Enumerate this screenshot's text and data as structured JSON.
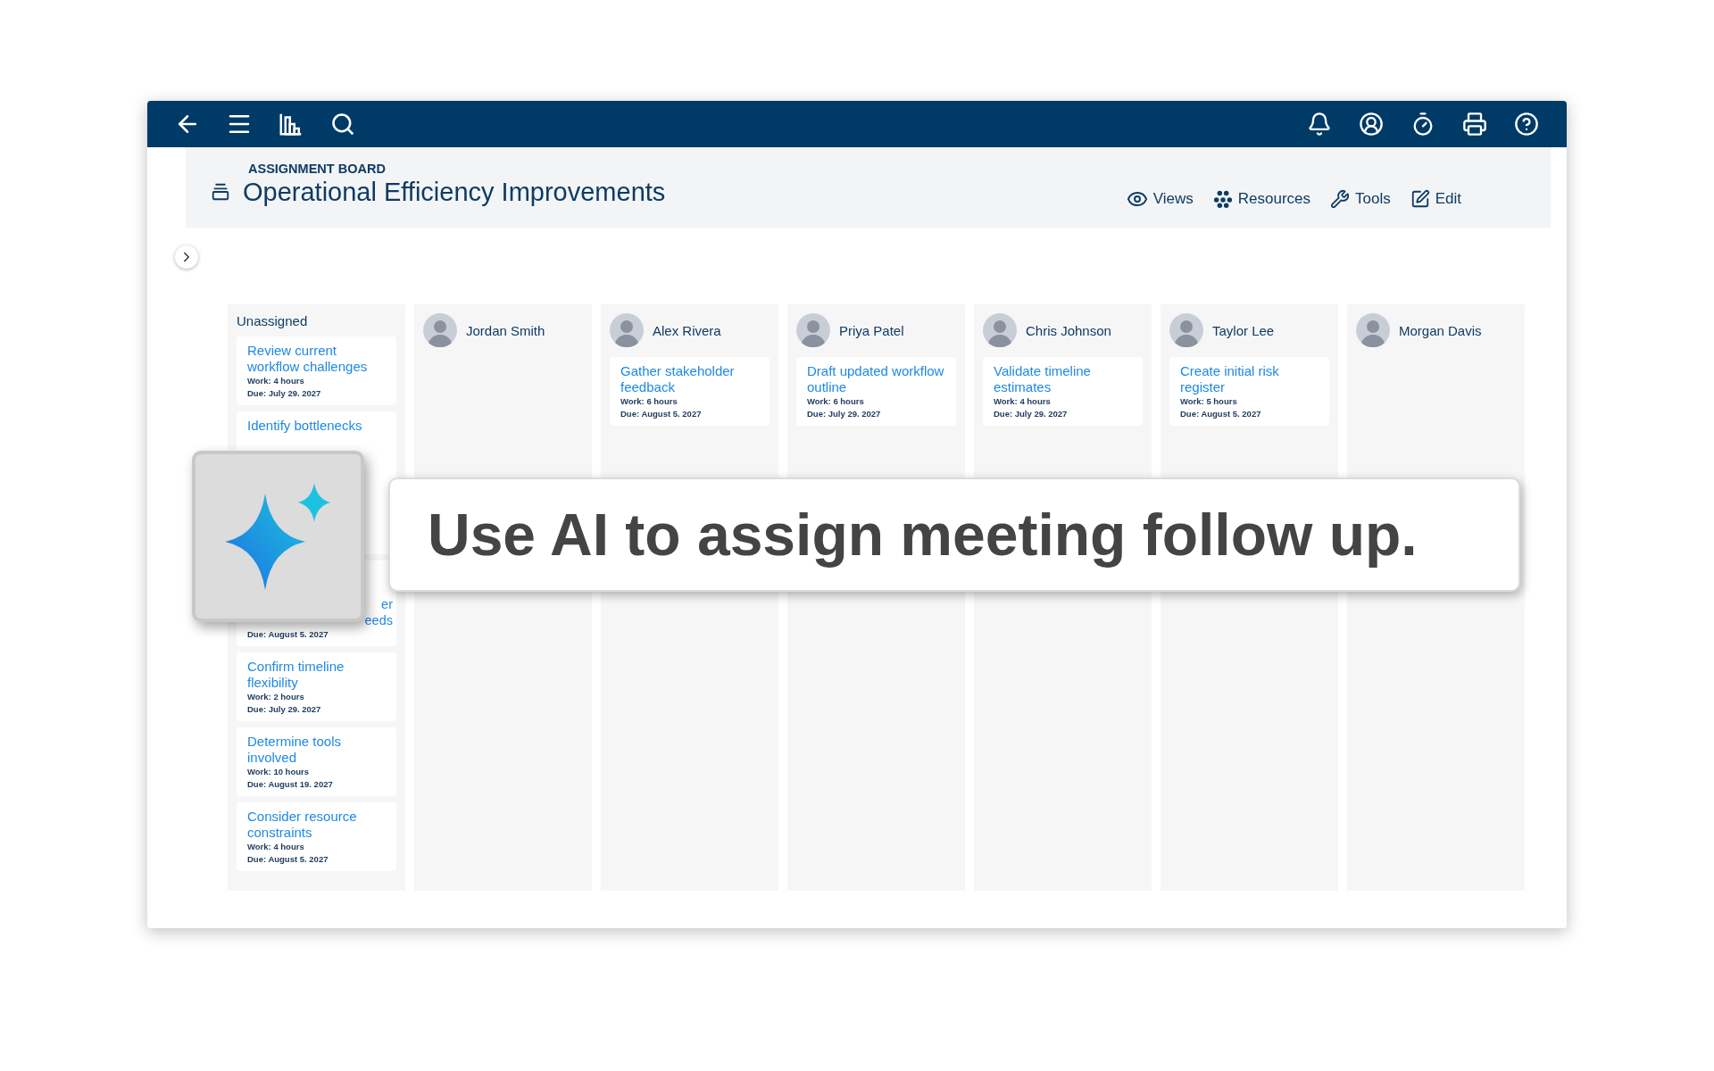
{
  "header": {
    "eyebrow": "ASSIGNMENT BOARD",
    "title": "Operational Efficiency Improvements",
    "actions": [
      {
        "kind": "views",
        "label": "Views"
      },
      {
        "kind": "resources",
        "label": "Resources"
      },
      {
        "kind": "tools",
        "label": "Tools"
      },
      {
        "kind": "edit",
        "label": "Edit"
      }
    ]
  },
  "columns": [
    {
      "kind": "unassigned",
      "title": "Unassigned",
      "cards": [
        {
          "kind": "full",
          "title": "Review current workflow challenges",
          "work": "Work: 4 hours",
          "due": "Due: July 29. 2027"
        },
        {
          "kind": "title_only",
          "title": "Identify bottlenecks"
        },
        {
          "kind": "fragment",
          "fragments": [
            "er",
            "eeds"
          ],
          "due": "Due: August 5. 2027"
        },
        {
          "kind": "full",
          "title": "Confirm timeline flexibility",
          "work": "Work: 2 hours",
          "due": "Due: July 29. 2027"
        },
        {
          "kind": "full",
          "title": "Determine tools involved",
          "work": "Work: 10 hours",
          "due": "Due: August 19. 2027"
        },
        {
          "kind": "full",
          "title": "Consider resource constraints",
          "work": "Work: 4 hours",
          "due": "Due: August 5. 2027"
        }
      ]
    },
    {
      "kind": "person",
      "title": "Jordan Smith"
    },
    {
      "kind": "person",
      "title": "Alex Rivera",
      "cards": [
        {
          "kind": "full",
          "title": "Gather stakeholder feedback",
          "work": "Work: 6 hours",
          "due": "Due: August 5. 2027"
        }
      ]
    },
    {
      "kind": "person",
      "title": "Priya Patel",
      "cards": [
        {
          "kind": "full",
          "title": "Draft updated workflow outline",
          "work": "Work: 6 hours",
          "due": "Due: July 29. 2027"
        }
      ]
    },
    {
      "kind": "person",
      "title": "Chris Johnson",
      "cards": [
        {
          "kind": "full",
          "title": "Validate timeline estimates",
          "work": "Work: 4 hours",
          "due": "Due: July 29. 2027"
        }
      ]
    },
    {
      "kind": "person",
      "title": "Taylor Lee",
      "cards": [
        {
          "kind": "full",
          "title": "Create initial risk register",
          "work": "Work: 5 hours",
          "due": "Due: August 5. 2027"
        }
      ]
    },
    {
      "kind": "person",
      "title": "Morgan Davis"
    }
  ],
  "banner": {
    "text": "Use AI to assign meeting follow up."
  }
}
